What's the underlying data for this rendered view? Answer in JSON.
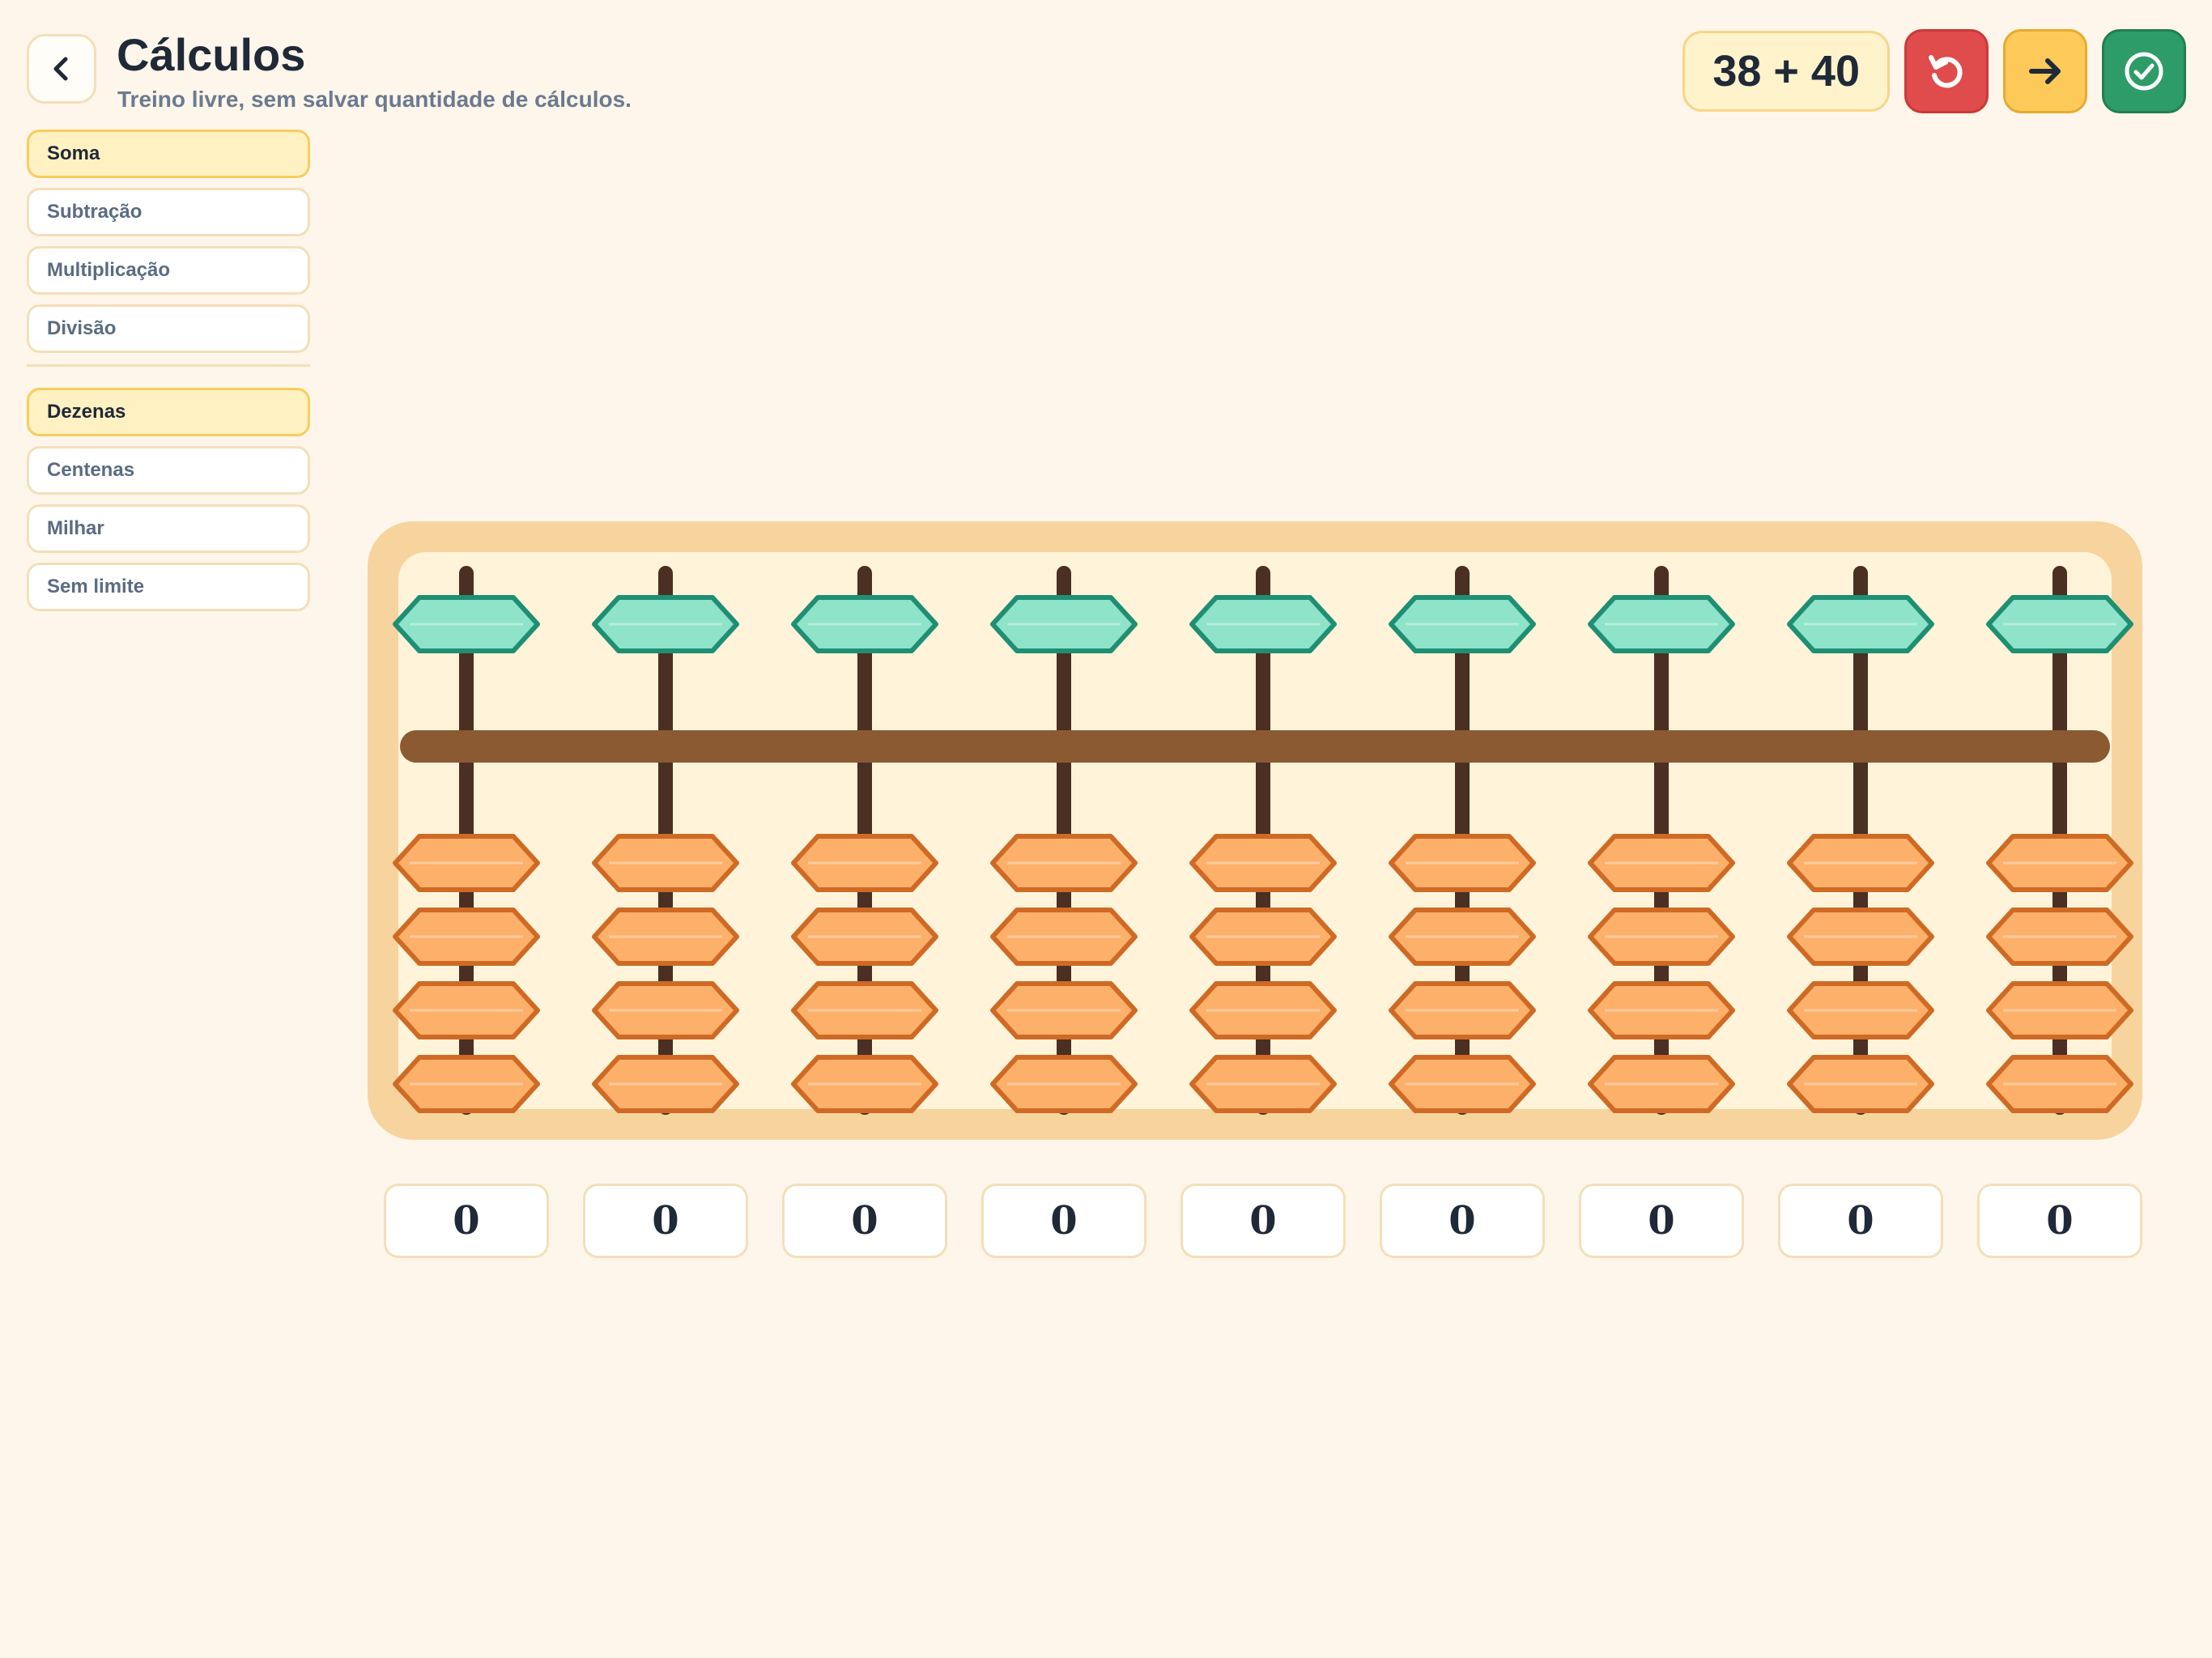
{
  "header": {
    "title": "Cálculos",
    "subtitle": "Treino livre, sem salvar quantidade de cálculos.",
    "back_icon": "chevron-left-icon"
  },
  "sidebar": {
    "operations": [
      {
        "label": "Soma",
        "active": true
      },
      {
        "label": "Subtração",
        "active": false
      },
      {
        "label": "Multiplicação",
        "active": false
      },
      {
        "label": "Divisão",
        "active": false
      }
    ],
    "ranges": [
      {
        "label": "Dezenas",
        "active": true
      },
      {
        "label": "Centenas",
        "active": false
      },
      {
        "label": "Milhar",
        "active": false
      },
      {
        "label": "Sem limite",
        "active": false
      }
    ]
  },
  "toolbar": {
    "problem": "38 + 40",
    "reset_icon": "reset-icon",
    "next_icon": "arrow-right-icon",
    "check_icon": "check-circle-icon"
  },
  "abacus": {
    "rod_count": 9,
    "digits": [
      "0",
      "0",
      "0",
      "0",
      "0",
      "0",
      "0",
      "0",
      "0"
    ]
  },
  "colors": {
    "background": "#fef6ea",
    "heaven_bead": "#8ee3c8",
    "heaven_bead_stroke": "#1f8f74",
    "earth_bead": "#fdb06a",
    "earth_bead_stroke": "#cf6a25",
    "beam": "#8b5a32",
    "rod": "#4a2f22",
    "reset": "#e04b4b",
    "next": "#fdca5a",
    "check": "#2e9c68"
  }
}
